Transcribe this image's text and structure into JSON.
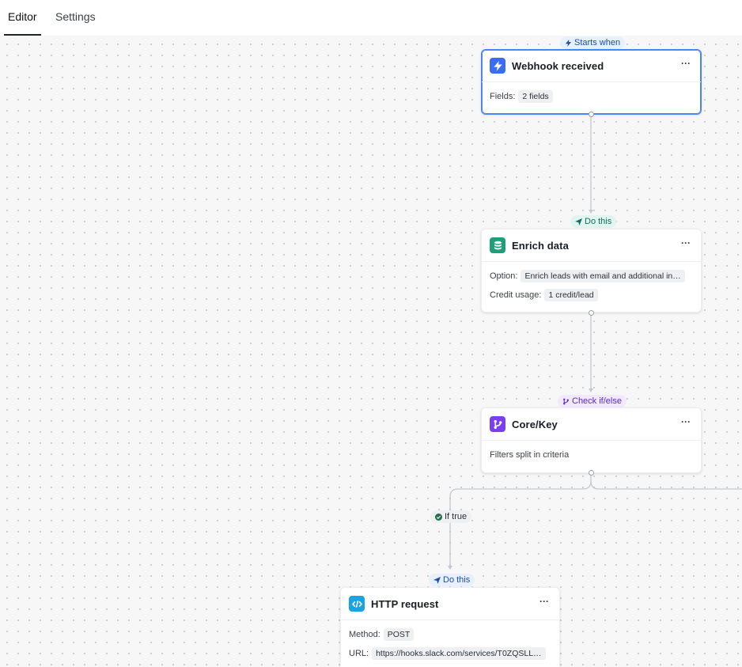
{
  "tabs": [
    {
      "label": "Editor",
      "active": true
    },
    {
      "label": "Settings",
      "active": false
    }
  ],
  "labels": {
    "starts_when": "Starts when",
    "do_this_1": "Do this",
    "check_if_else": "Check if/else",
    "if_true": "If true",
    "do_this_2": "Do this"
  },
  "nodes": {
    "webhook": {
      "title": "Webhook received",
      "more": "···",
      "fields_label": "Fields:",
      "fields_value": "2 fields"
    },
    "enrich": {
      "title": "Enrich data",
      "more": "···",
      "option_label": "Option:",
      "option_value": "Enrich leads with email and additional in…",
      "credit_label": "Credit usage:",
      "credit_value": "1 credit/lead"
    },
    "corekey": {
      "title": "Core/Key",
      "more": "···",
      "description": "Filters split in criteria"
    },
    "http": {
      "title": "HTTP request",
      "more": "···",
      "method_label": "Method:",
      "method_value": "POST",
      "url_label": "URL:",
      "url_value": "https://hooks.slack.com/services/T0ZQSLL…"
    }
  },
  "colors": {
    "webhook_icon": "#3b6cf6",
    "enrich_icon": "#1f9e7a",
    "corekey_icon": "#7a3ff0",
    "http_icon": "#1aa3e0",
    "selected_border": "#4a84f5"
  },
  "icons": {
    "webhook": "lightning-icon",
    "enrich": "database-icon",
    "corekey": "branch-icon",
    "http": "code-icon"
  }
}
